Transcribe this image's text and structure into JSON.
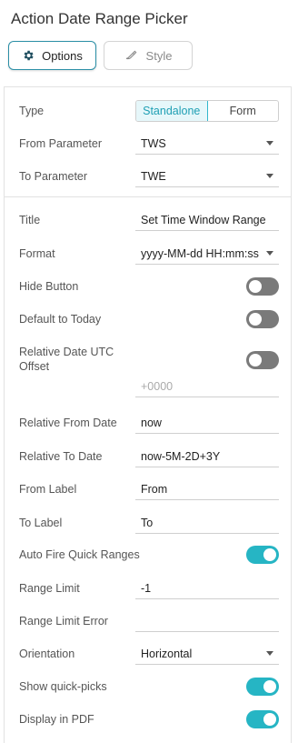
{
  "panel": {
    "title": "Action Date Range Picker"
  },
  "tabs": [
    {
      "label": "Options",
      "icon": "gear-icon",
      "active": true
    },
    {
      "label": "Style",
      "icon": "brush-icon",
      "active": false
    }
  ],
  "colors": {
    "accent": "#26b5c4",
    "toggle_off": "#7a7a7a",
    "tab_border": "#2b8fa6"
  },
  "general": {
    "type_label": "Type",
    "type_options": [
      "Standalone",
      "Form"
    ],
    "type_selected": "Standalone",
    "from_parameter_label": "From Parameter",
    "from_parameter_value": "TWS",
    "to_parameter_label": "To Parameter",
    "to_parameter_value": "TWE"
  },
  "settings": {
    "title_label": "Title",
    "title_value": "Set Time Window Range",
    "format_label": "Format",
    "format_value": "yyyy-MM-dd HH:mm:ss",
    "hide_button_label": "Hide Button",
    "hide_button_on": false,
    "default_today_label": "Default to Today",
    "default_today_on": false,
    "utc_offset_label_line1": "Relative Date UTC",
    "utc_offset_label_line2": "Offset",
    "utc_offset_on": false,
    "utc_offset_placeholder": "+0000",
    "relative_from_label": "Relative From Date",
    "relative_from_value": "now",
    "relative_to_label": "Relative To Date",
    "relative_to_value": "now-5M-2D+3Y",
    "from_label_label": "From Label",
    "from_label_value": "From",
    "to_label_label": "To Label",
    "to_label_value": "To",
    "auto_fire_label": "Auto Fire Quick Ranges",
    "auto_fire_on": true,
    "range_limit_label": "Range Limit",
    "range_limit_value": "-1",
    "range_limit_error_label": "Range Limit Error",
    "range_limit_error_value": "",
    "orientation_label": "Orientation",
    "orientation_value": "Horizontal",
    "show_quick_picks_label": "Show quick-picks",
    "show_quick_picks_on": true,
    "display_pdf_label": "Display in PDF",
    "display_pdf_on": true
  }
}
